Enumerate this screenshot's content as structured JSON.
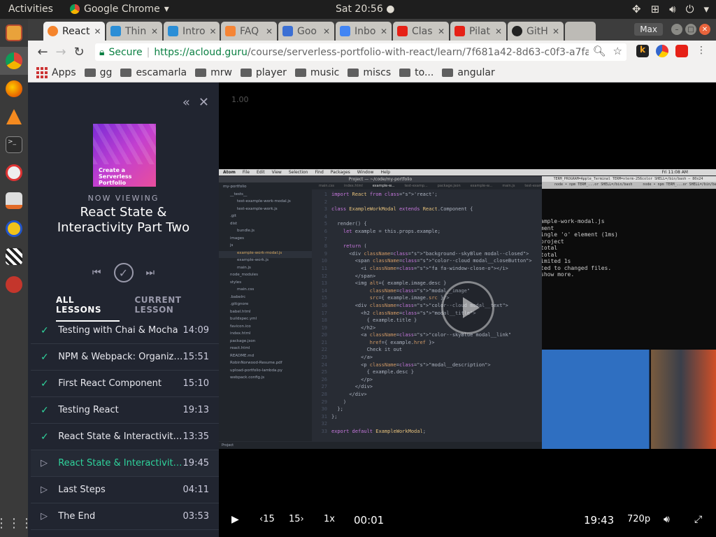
{
  "topbar": {
    "activities": "Activities",
    "app_name": "Google Chrome",
    "clock": "Sat 20:56"
  },
  "dock": {
    "apps": [
      "files-icon",
      "chrome-icon",
      "firefox-icon",
      "vlc-icon",
      "terminal-icon",
      "help-icon",
      "installer-icon",
      "headphones-icon",
      "clapper-icon",
      "settings-icon"
    ],
    "show_apps_icon": "grid-icon"
  },
  "tabs": [
    {
      "label": "React",
      "icon": "acloud-icon",
      "color": "#f5842c"
    },
    {
      "label": "Thin",
      "icon": "vscode-icon",
      "color": "#2b8ed6"
    },
    {
      "label": "Intro",
      "icon": "vscode-icon",
      "color": "#2b8ed6"
    },
    {
      "label": "FAQ",
      "icon": "aws-icon",
      "color": "#f58536"
    },
    {
      "label": "Goo",
      "icon": "calendar-icon",
      "color": "#3b6fd4"
    },
    {
      "label": "Inbo",
      "icon": "inbox-icon",
      "color": "#4285f4"
    },
    {
      "label": "Clas",
      "icon": "youtube-icon",
      "color": "#e62117"
    },
    {
      "label": "Pilat",
      "icon": "youtube-icon",
      "color": "#e62117"
    },
    {
      "label": "GitH",
      "icon": "github-icon",
      "color": "#222222"
    }
  ],
  "window": {
    "max_label": "Max"
  },
  "omnibox": {
    "secure": "Secure",
    "url_base": "https://acloud.guru",
    "url_rest": "/course/serverless-portfolio-with-react/learn/7f681a42-8d63-c0f3-a7fa-6bff..."
  },
  "bookmarks": {
    "apps": "Apps",
    "folders": [
      "gg",
      "escamarla",
      "mrw",
      "player",
      "music",
      "miscs",
      "to...",
      "angular"
    ]
  },
  "sidebar": {
    "course_thumb": "Create a Serverless Portfolio",
    "now_viewing": "NOW VIEWING",
    "lesson_title": "React State & Interactivity Part Two",
    "tab_all": "ALL LESSONS",
    "tab_current": "CURRENT LESSON",
    "lessons": [
      {
        "name": "Testing with Chai & Mocha",
        "dur": "14:09",
        "status": "done"
      },
      {
        "name": "NPM & Webpack: Organizing ...",
        "dur": "15:51",
        "status": "done"
      },
      {
        "name": "First React Component",
        "dur": "15:10",
        "status": "done"
      },
      {
        "name": "Testing React",
        "dur": "19:13",
        "status": "done"
      },
      {
        "name": "React State & Interactivity Pa...",
        "dur": "13:35",
        "status": "done"
      },
      {
        "name": "React State & Interactivity Pa...",
        "dur": "19:45",
        "status": "current"
      },
      {
        "name": "Last Steps",
        "dur": "04:11",
        "status": "todo"
      },
      {
        "name": "The End",
        "dur": "03:53",
        "status": "todo"
      }
    ]
  },
  "player": {
    "speed_overlay": "1.00",
    "current_time": "00:01",
    "duration": "19:43",
    "quality": "720p",
    "rate": "1x",
    "rewind": "15",
    "forward": "15"
  },
  "video_frame": {
    "atom_title": "Project — ~/code/my-portfolio",
    "mac_menu": [
      "Atom",
      "File",
      "Edit",
      "View",
      "Selection",
      "Find",
      "Packages",
      "Window",
      "Help"
    ],
    "mac_clock": "Fri 11:08 AM",
    "editor_tabs": [
      "main.css",
      "index.html",
      "example-w...",
      "test-examp...",
      "package.json",
      "example-w...",
      "main.js",
      "test-examp..."
    ],
    "tree": [
      "my-portfolio",
      "__tests__",
      "test-example-work-modal.js",
      "test-example-work.js",
      ".git",
      "dist",
      "bundle.js",
      "images",
      "js",
      "example-work-modal.js",
      "example-work.js",
      "main.js",
      "node_modules",
      "styles",
      "main.css",
      ".babelrc",
      ".gitignore",
      "babel.html",
      "buildspec.yml",
      "favicon.ico",
      "index.html",
      "package.json",
      "react.html",
      "README.md",
      "RobinNorwood-Resume.pdf",
      "upload-portfolio-lambda.py",
      "webpack.config.js"
    ],
    "tree_selected": "example-work-modal.js",
    "status_text": "Project",
    "code_lines": [
      "import React from 'react';",
      "",
      "class ExampleWorkModal extends React.Component {",
      "",
      "  render() {",
      "    let example = this.props.example;",
      "",
      "    return (",
      "      <div className=\"background--skyBlue modal--closed\">",
      "        <span className=\"color--cloud modal__closeButton\">",
      "          <i className=\"fa fa-window-close-o\"></i>",
      "        </span>",
      "        <img alt={ example.image.desc }",
      "             className=\"modal__image\"",
      "             src={ example.image.src }/>",
      "        <div className=\"color--cloud modal__text\">",
      "          <h2 className=\"modal__title\">",
      "            { example.title }",
      "          </h2>",
      "          <a className=\"color--skyBlue modal__link\"",
      "             href={ example.href }>",
      "            Check it out",
      "          </a>",
      "          <p className=\"modal__description\">",
      "            { example.desc }",
      "          </p>",
      "        </div>",
      "      </div>",
      "    )",
      "  };",
      "};",
      "",
      "export default ExampleWorkModal;"
    ],
    "terminal_title": "TERM_PROGRAM=Apple_Terminal TERM=xterm-256color SHELL=/bin/bash — 80x24",
    "terminal_tabs": "node • npm TERM_...or SHELL=/bin/bash     node • npm TERM_...or SHELL=/bin/bash",
    "terminal_lines": [
      "ample-work-modal.js",
      "ment",
      "ingle 'o' element (1ms)",
      "project",
      "",
      "total",
      "total",
      "",
      "imited 1s",
      "ted to changed files.",
      "",
      "show more."
    ]
  }
}
